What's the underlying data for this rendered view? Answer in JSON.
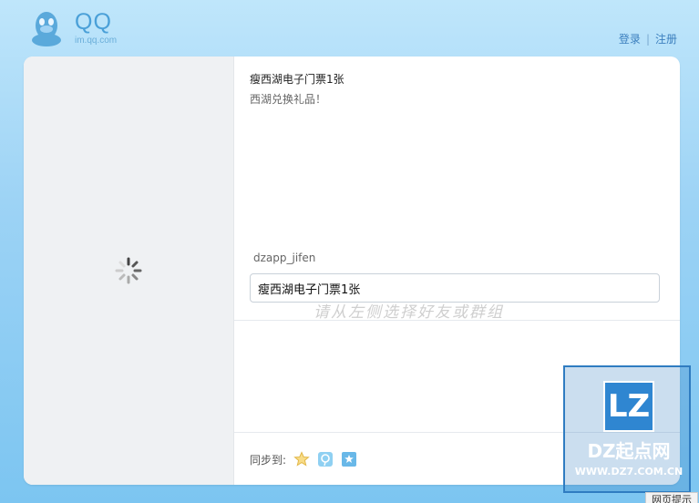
{
  "header": {
    "brand_title": "QQ",
    "brand_sub": "im.qq.com",
    "login_label": "登录",
    "separator": "|",
    "register_label": "注册"
  },
  "content": {
    "title": "瘦西湖电子门票1张",
    "description": "西湖兑换礼品！",
    "app_name": "dzapp_jifen",
    "message_value": "瘦西湖电子门票1张",
    "friend_hint": "请从左侧选择好友或群组",
    "sync_label": "同步到:"
  },
  "sync_icons": [
    "qzone-star-icon",
    "tencent-weibo-icon",
    "pengyou-icon"
  ],
  "watermark": {
    "badge": "LZ",
    "name": "DZ起点网",
    "url": "WWW.DZ7.COM.CN"
  },
  "tip": {
    "label": "网页提示"
  }
}
